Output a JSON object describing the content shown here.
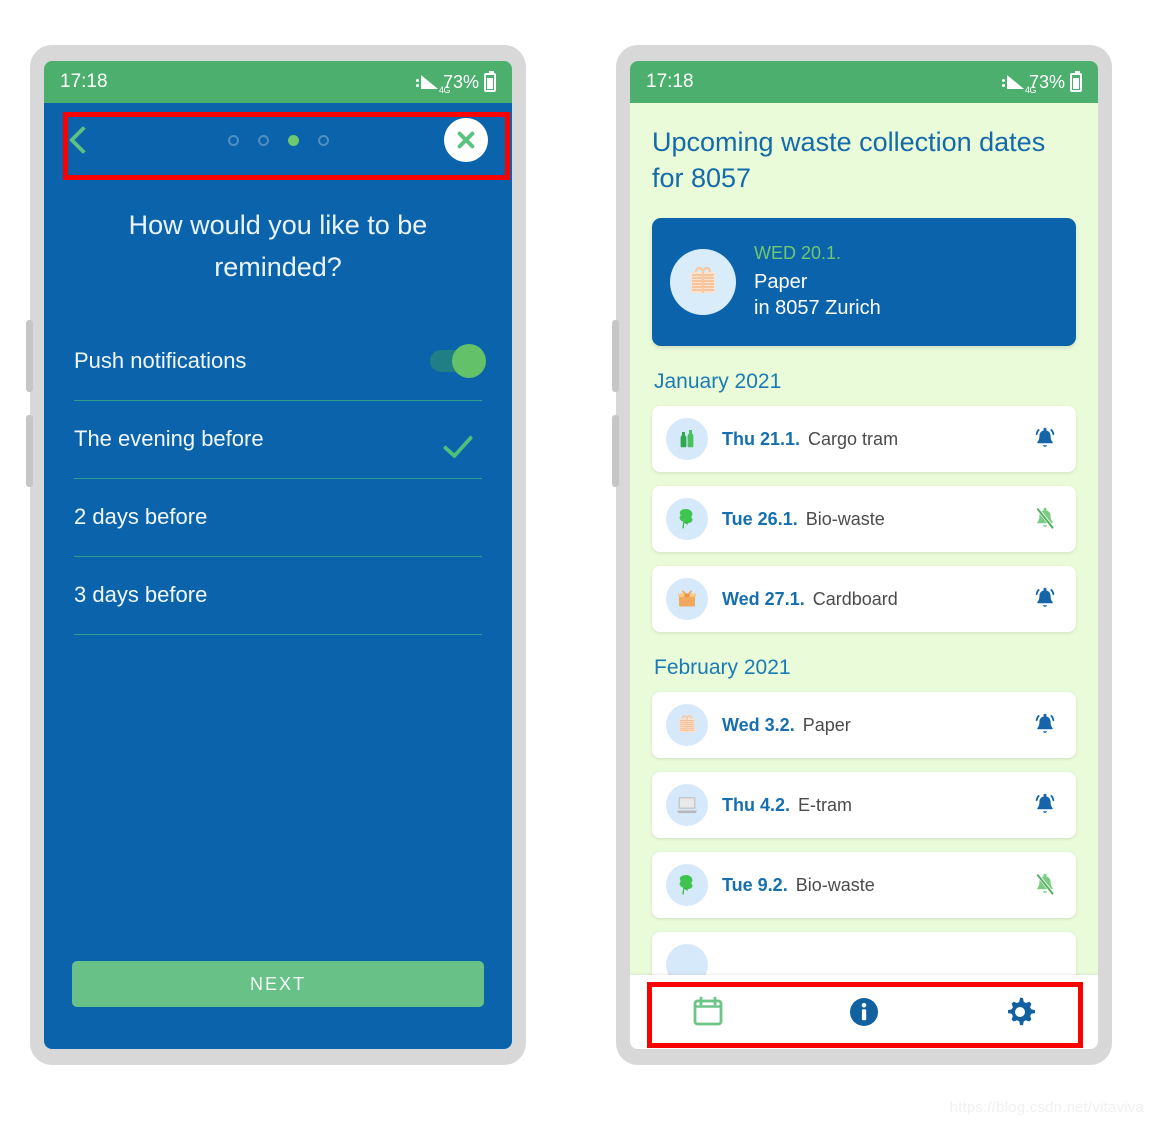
{
  "status_bar": {
    "time": "17:18",
    "network": "4G",
    "battery": "73%"
  },
  "left_phone": {
    "nav": {
      "back_icon": "chevron-left-icon",
      "close_icon": "close-x-icon",
      "dots_total": 4,
      "dot_active_index": 3
    },
    "title": "How would you like to be reminded?",
    "options": [
      {
        "label": "Push notifications",
        "control": "toggle",
        "state": "on"
      },
      {
        "label": "The evening before",
        "control": "check",
        "state": "selected"
      },
      {
        "label": "2 days before",
        "control": "none",
        "state": "unselected"
      },
      {
        "label": "3 days before",
        "control": "none",
        "state": "unselected"
      }
    ],
    "next_label": "NEXT"
  },
  "right_phone": {
    "title": "Upcoming waste collection dates for 8057",
    "hero": {
      "date": "WED 20.1.",
      "type": "Paper",
      "location": "in 8057 Zurich",
      "icon": "paper-bundle-icon"
    },
    "sections": [
      {
        "month": "January 2021",
        "items": [
          {
            "date": "Thu 21.1.",
            "type": "Cargo tram",
            "icon": "bottles-icon",
            "bell": "bell-on"
          },
          {
            "date": "Tue 26.1.",
            "type": "Bio-waste",
            "icon": "plant-icon",
            "bell": "bell-off"
          },
          {
            "date": "Wed 27.1.",
            "type": "Cardboard",
            "icon": "box-icon",
            "bell": "bell-on"
          }
        ]
      },
      {
        "month": "February 2021",
        "items": [
          {
            "date": "Wed 3.2.",
            "type": "Paper",
            "icon": "paper-bundle-icon",
            "bell": "bell-on"
          },
          {
            "date": "Thu 4.2.",
            "type": "E-tram",
            "icon": "computer-icon",
            "bell": "bell-on"
          },
          {
            "date": "Tue 9.2.",
            "type": "Bio-waste",
            "icon": "plant-icon",
            "bell": "bell-off"
          }
        ]
      }
    ],
    "bottom_nav": [
      {
        "name": "calendar-icon",
        "active": false
      },
      {
        "name": "info-icon",
        "active": true
      },
      {
        "name": "gear-icon",
        "active": true
      }
    ]
  },
  "annotations": {
    "highlight_color": "#fb0000",
    "boxes": [
      "left-phone-top-nav",
      "right-phone-bottom-nav"
    ]
  },
  "watermark": "https://blog.csdn.net/vitaviva",
  "colors": {
    "status_green": "#4caf6d",
    "brand_blue": "#0b63ac",
    "accent_green": "#68c288",
    "list_bg": "#e9fbd9",
    "card_white": "#ffffff",
    "divider_teal": "#2f9e8f"
  }
}
